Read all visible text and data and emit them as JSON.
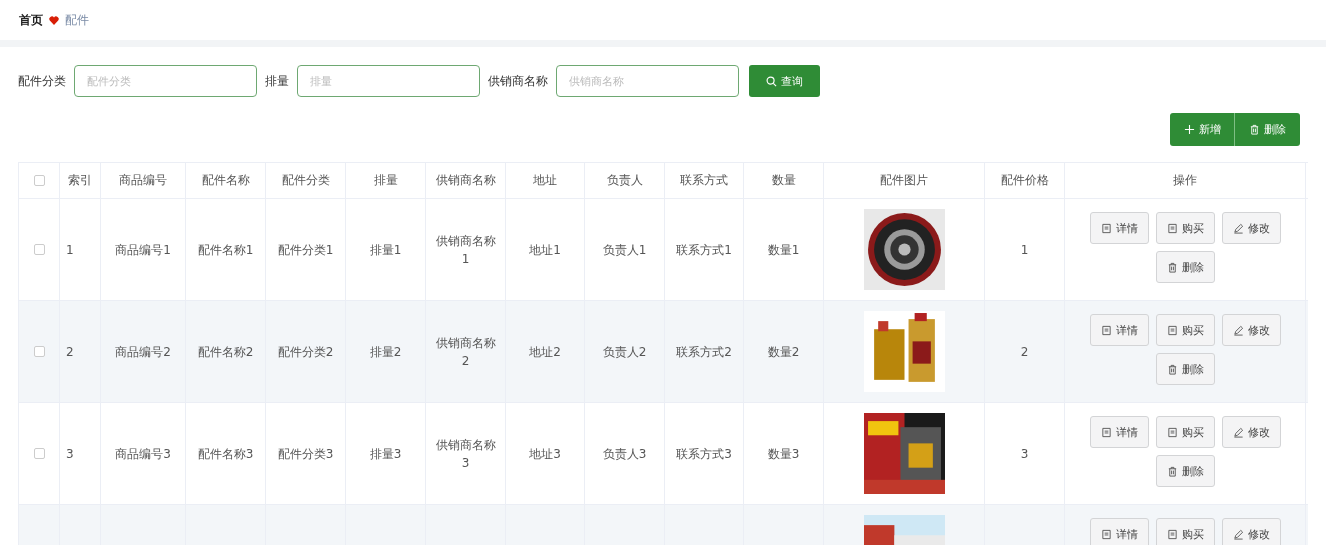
{
  "breadcrumb": {
    "home": "首页",
    "current": "配件"
  },
  "filters": [
    {
      "label": "配件分类",
      "placeholder": "配件分类"
    },
    {
      "label": "排量",
      "placeholder": "排量"
    },
    {
      "label": "供销商名称",
      "placeholder": "供销商名称"
    }
  ],
  "search_button": "查询",
  "toolbar": [
    {
      "label": "新增",
      "kind": "add"
    },
    {
      "label": "删除",
      "kind": "delete"
    }
  ],
  "table": {
    "header_checkbox": {
      "checked": false
    },
    "columns": [
      "索引",
      "商品编号",
      "配件名称",
      "配件分类",
      "排量",
      "供销商名称",
      "地址",
      "负责人",
      "联系方式",
      "数量",
      "配件图片",
      "配件价格",
      "操作"
    ],
    "rows": [
      {
        "checked": false,
        "cells": [
          "1",
          "商品编号1",
          "配件名称1",
          "配件分类1",
          "排量1",
          "供销商名称1",
          "地址1",
          "负责人1",
          "联系方式1",
          "数量1"
        ],
        "image": {
          "kind": "picture"
        },
        "price": "1",
        "actions": [
          {
            "label": "详情",
            "kind": "detail"
          },
          {
            "label": "购买",
            "kind": "detail"
          },
          {
            "label": "修改",
            "kind": "edit"
          },
          {
            "label": "删除",
            "kind": "delete"
          }
        ]
      },
      {
        "checked": false,
        "cells": [
          "2",
          "商品编号2",
          "配件名称2",
          "配件分类2",
          "排量2",
          "供销商名称2",
          "地址2",
          "负责人2",
          "联系方式2",
          "数量2"
        ],
        "image": {
          "kind": "picture"
        },
        "price": "2",
        "actions": [
          {
            "label": "详情",
            "kind": "detail"
          },
          {
            "label": "购买",
            "kind": "detail"
          },
          {
            "label": "修改",
            "kind": "edit"
          },
          {
            "label": "删除",
            "kind": "delete"
          }
        ]
      },
      {
        "checked": false,
        "cells": [
          "3",
          "商品编号3",
          "配件名称3",
          "配件分类3",
          "排量3",
          "供销商名称3",
          "地址3",
          "负责人3",
          "联系方式3",
          "数量3"
        ],
        "image": {
          "kind": "picture"
        },
        "price": "3",
        "actions": [
          {
            "label": "详情",
            "kind": "detail"
          },
          {
            "label": "购买",
            "kind": "detail"
          },
          {
            "label": "修改",
            "kind": "edit"
          },
          {
            "label": "删除",
            "kind": "delete"
          }
        ]
      },
      {
        "image": {
          "kind": "picture"
        },
        "actions": [
          {
            "label": "详情",
            "kind": "detail"
          },
          {
            "label": "购买",
            "kind": "detail"
          },
          {
            "label": "修改",
            "kind": "edit"
          }
        ]
      }
    ]
  }
}
